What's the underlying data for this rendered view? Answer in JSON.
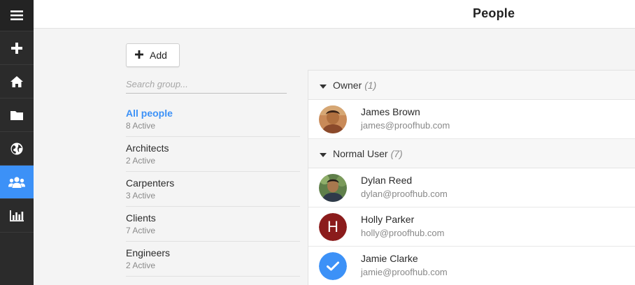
{
  "header": {
    "title": "People"
  },
  "rail": {
    "items": [
      {
        "icon": "menu-icon"
      },
      {
        "icon": "plus-icon"
      },
      {
        "icon": "home-icon"
      },
      {
        "icon": "folder-icon"
      },
      {
        "icon": "globe-icon"
      },
      {
        "icon": "people-icon",
        "active": true
      },
      {
        "icon": "reports-icon"
      }
    ],
    "accent": "#3c91f7"
  },
  "toolbar": {
    "add_label": "Add"
  },
  "search": {
    "placeholder": "Search group..."
  },
  "groups": [
    {
      "name": "All people",
      "count": "8 Active",
      "active": true
    },
    {
      "name": "Architects",
      "count": "2 Active"
    },
    {
      "name": "Carpenters",
      "count": "3 Active"
    },
    {
      "name": "Clients",
      "count": "7 Active"
    },
    {
      "name": "Engineers",
      "count": "2 Active"
    }
  ],
  "sections": [
    {
      "title": "Owner",
      "count": "(1)",
      "people": [
        {
          "name": "James Brown",
          "email": "james@proofhub.com",
          "avatar": "photo"
        }
      ]
    },
    {
      "title": "Normal User",
      "count": "(7)",
      "people": [
        {
          "name": "Dylan Reed",
          "email": "dylan@proofhub.com",
          "avatar": "photo"
        },
        {
          "name": "Holly Parker",
          "email": "holly@proofhub.com",
          "avatar": "letter",
          "letter": "H",
          "color": "#8b1c1c"
        },
        {
          "name": "Jamie Clarke",
          "email": "jamie@proofhub.com",
          "avatar": "check",
          "color": "#3c91f7"
        }
      ]
    }
  ]
}
